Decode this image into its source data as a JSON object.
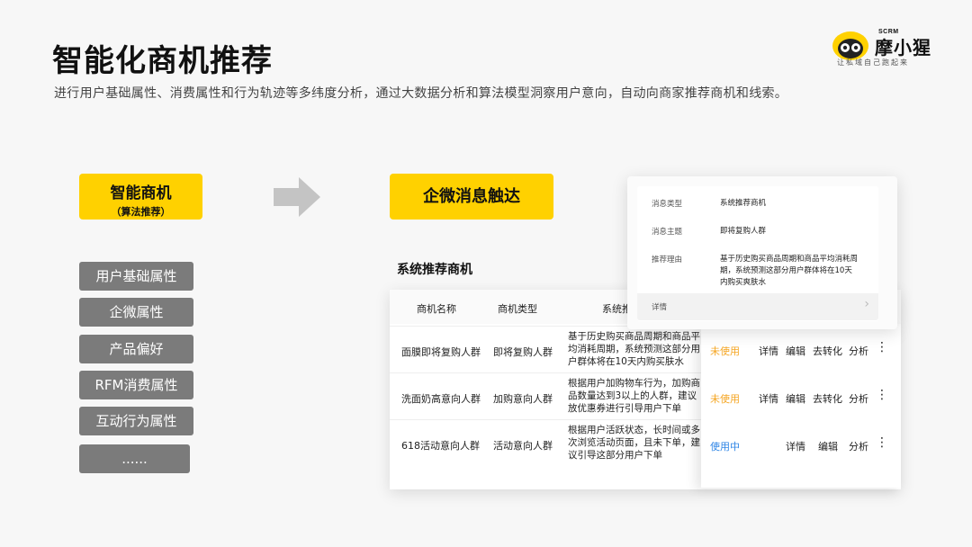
{
  "title": "智能化商机推荐",
  "subtitle": "进行用户基础属性、消费属性和行为轨迹等多纬度分析，通过大数据分析和算法模型洞察用户意向，自动向商家推荐商机和线索。",
  "logo": {
    "brand_small": "SCRM",
    "brand": "摩小猩",
    "tagline": "让私域自己跑起来"
  },
  "smart_box": {
    "main": "智能商机",
    "sub": "（算法推荐）"
  },
  "attributes": [
    "用户基础属性",
    "企微属性",
    "产品偏好",
    "RFM消费属性",
    "互动行为属性",
    "......"
  ],
  "wecom_box": "企微消息触达",
  "section_label": "系统推荐商机",
  "table": {
    "headers": [
      "商机名称",
      "商机类型",
      "系统推"
    ],
    "rows": [
      {
        "name": "面膜即将复购人群",
        "type": "即将复购人群",
        "reason": [
          "基于历史购买商品周期和商品平",
          "均消耗周期，系统预测这部分用",
          "户群体将在10天内购买肤水"
        ],
        "status": "未使用",
        "actions": [
          "详情",
          "编辑",
          "去转化",
          "分析"
        ]
      },
      {
        "name": "洗面奶高意向人群",
        "type": "加购意向人群",
        "reason": [
          "根据用户加购物车行为，加购商",
          "品数量达到3以上的人群，建议",
          "放优惠券进行引导用户下单"
        ],
        "status": "未使用",
        "actions": [
          "详情",
          "编辑",
          "去转化",
          "分析"
        ]
      },
      {
        "name": "618活动意向人群",
        "type": "活动意向人群",
        "reason": [
          "根据用户活跃状态，长时间或多",
          "次浏览活动页面，且未下单，建",
          "议引导这部分用户下单"
        ],
        "status": "使用中",
        "actions": [
          "详情",
          "编辑",
          "分析"
        ]
      }
    ]
  },
  "popover": {
    "fields": [
      {
        "label": "消息类型",
        "value": "系统推荐商机"
      },
      {
        "label": "消息主题",
        "value": "即将复购人群"
      },
      {
        "label": "推荐理由",
        "value": [
          "基于历史购买商品周期和商品平均消耗周",
          "期，系统预测这部分用户群体将在10天",
          "内购买爽肤水"
        ]
      }
    ],
    "detail_label": "详情"
  },
  "colors": {
    "accent": "#ffd100",
    "attr_bg": "#7b7b7b",
    "unused": "#f5a623",
    "active": "#2f86e6"
  }
}
